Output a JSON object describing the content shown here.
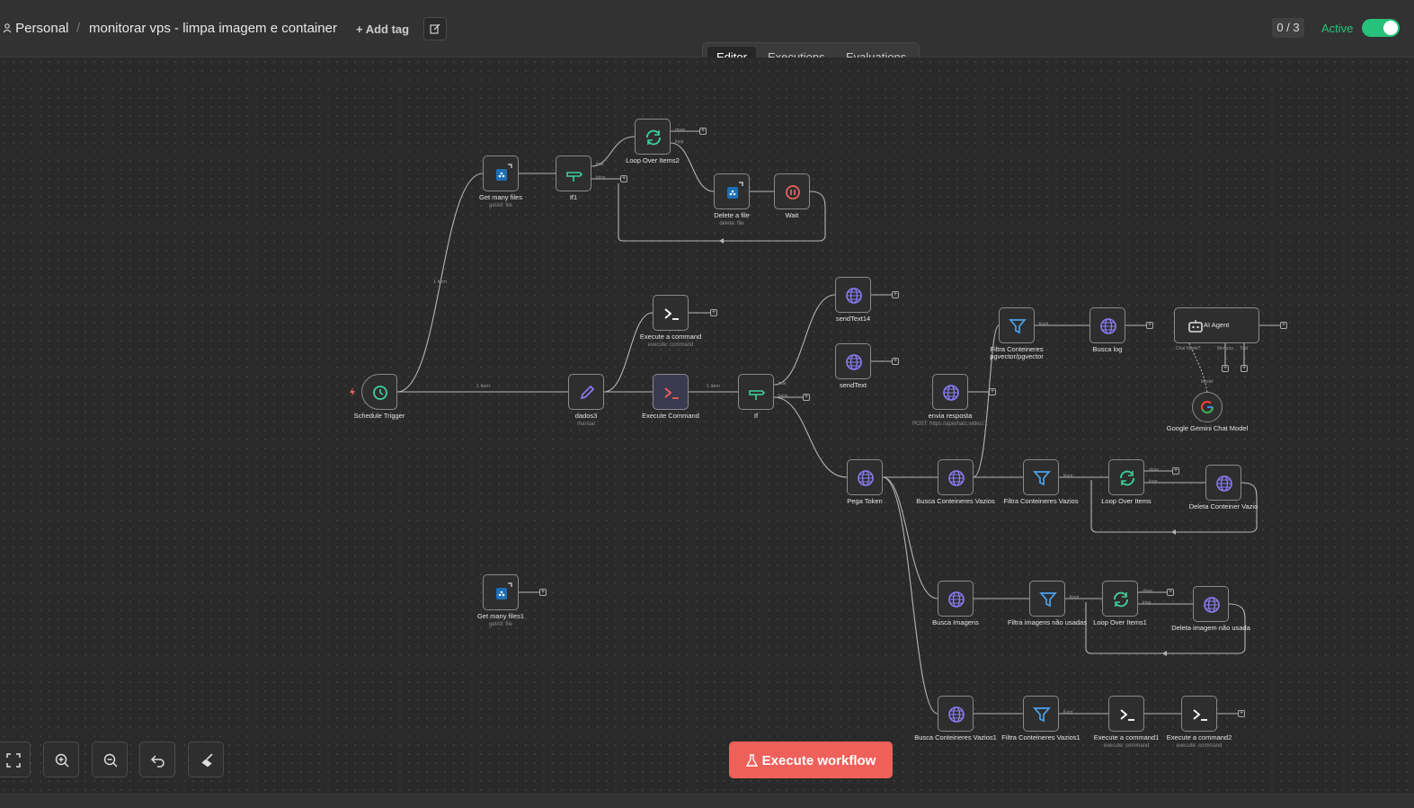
{
  "header": {
    "project": "Personal",
    "separator": "/",
    "workflow_name": "monitorar vps - limpa imagem e container",
    "add_tag": "+ Add tag",
    "counter": "0 / 3",
    "active_label": "Active",
    "active": true
  },
  "tabs": [
    {
      "label": "Editor",
      "active": true
    },
    {
      "label": "Executions",
      "active": false
    },
    {
      "label": "Evaluations",
      "active": false
    }
  ],
  "edges": {
    "schedule_to_get": "1 item",
    "schedule_to_dados": "1 item",
    "exec_to_if": "1 item"
  },
  "ports": {
    "done": "done",
    "loop": "loop",
    "true": "true",
    "false": "false",
    "kept": "Kept",
    "chat_model": "Chat Model*",
    "memory": "Memory",
    "tool": "Tool",
    "model": "Model"
  },
  "nodes": {
    "schedule": {
      "label": "Schedule Trigger",
      "icon": "clock-icon"
    },
    "get_many_files": {
      "label": "Get many files",
      "sub": "getAll: file",
      "icon": "docker-icon"
    },
    "if1": {
      "label": "If1",
      "icon": "if-icon"
    },
    "loop2": {
      "label": "Loop Over Items2",
      "icon": "loop-icon"
    },
    "delete_file": {
      "label": "Delete a file",
      "sub": "delete: file",
      "icon": "docker-icon"
    },
    "wait": {
      "label": "Wait",
      "icon": "pause-icon"
    },
    "exec_a_command": {
      "label": "Execute a command",
      "sub": "execute: command",
      "icon": "terminal-icon"
    },
    "dados3": {
      "label": "dados3",
      "sub": "manual",
      "icon": "pen-icon"
    },
    "execute_command": {
      "label": "Execute Command",
      "icon": "terminal-icon"
    },
    "if": {
      "label": "If",
      "icon": "if-icon"
    },
    "sendtext14": {
      "label": "sendText14",
      "icon": "globe-icon"
    },
    "sendtext": {
      "label": "sendText",
      "icon": "globe-icon"
    },
    "envia_resposta": {
      "label": "envia resposta",
      "sub": "POST: https://apiwhats.wbkici...",
      "icon": "globe-icon"
    },
    "filtra_pg": {
      "label": "Filtra Conteineres pgvector/pgvector",
      "icon": "filter-icon"
    },
    "busca_log": {
      "label": "Busca log",
      "icon": "globe-icon"
    },
    "ai_agent": {
      "label": "AI Agent",
      "icon": "robot-icon"
    },
    "gemini": {
      "label": "Google Gemini Chat Model",
      "icon": "google-icon"
    },
    "pega_token": {
      "label": "Pega Token",
      "icon": "globe-icon"
    },
    "busca_vazios": {
      "label": "Busca Conteineres Vazios",
      "icon": "globe-icon"
    },
    "filtra_vazios": {
      "label": "Filtra Conteineres Vazios",
      "icon": "filter-icon"
    },
    "loop_items": {
      "label": "Loop Over Items",
      "icon": "loop-icon"
    },
    "deleta_vazio": {
      "label": "Deleta Conteiner Vazio",
      "icon": "globe-icon"
    },
    "busca_imagens": {
      "label": "Busca Imagens",
      "icon": "globe-icon"
    },
    "filtra_imagens": {
      "label": "Filtra imagens não usadas",
      "icon": "filter-icon"
    },
    "loop_items1": {
      "label": "Loop Over Items1",
      "icon": "loop-icon"
    },
    "deleta_imagem": {
      "label": "Deleta imagem não usada",
      "icon": "globe-icon"
    },
    "busca_vazios1": {
      "label": "Busca Conteineres Vazios1",
      "icon": "globe-icon"
    },
    "filtra_vazios1": {
      "label": "Filtra Conteineres Vazios1",
      "icon": "filter-icon"
    },
    "exec_command1": {
      "label": "Execute a command1",
      "sub": "execute: command",
      "icon": "terminal-icon"
    },
    "exec_command2": {
      "label": "Execute a command2",
      "sub": "execute: command",
      "icon": "terminal-icon"
    },
    "get_many_files1": {
      "label": "Get many files1",
      "sub": "getAll: file",
      "icon": "docker-icon"
    }
  },
  "execute_button": "Execute workflow",
  "colors": {
    "accent": "#f0605a",
    "active": "#27c17b",
    "globe": "#8b7cf6",
    "filter": "#4aa3f0",
    "loop": "#3fd09a"
  }
}
